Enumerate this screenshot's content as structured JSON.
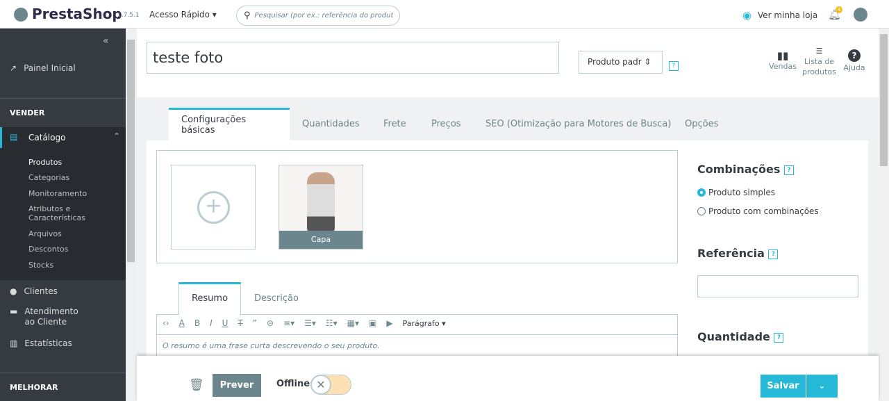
{
  "header": {
    "brand": "PrestaShop",
    "version": "1.7.5.1",
    "quick_access": "Acesso Rápido",
    "search_placeholder": "Pesquisar (por ex.: referência do produt",
    "view_store": "Ver minha loja",
    "notif_count": "4"
  },
  "sidebar": {
    "collapse": "«",
    "dashboard": "Painel Inicial",
    "sell_header": "VENDER",
    "catalog": "Catálogo",
    "catalog_items": [
      "Produtos",
      "Categorias",
      "Monitoramento",
      "Atributos e Características",
      "Arquivos",
      "Descontos",
      "Stocks"
    ],
    "customers": "Clientes",
    "service": "Atendimento ao Cliente",
    "stats": "Estatísticas",
    "improve_header": "MELHORAR"
  },
  "product": {
    "name": "teste foto",
    "type": "Produto padr",
    "help": "?"
  },
  "toolbar": {
    "sales": "Vendas",
    "list": "Lista de produtos",
    "help": "Ajuda"
  },
  "tabs": [
    "Configurações básicas",
    "Quantidades",
    "Frete",
    "Preços",
    "SEO (Otimização para Motores de Busca)",
    "Opções"
  ],
  "images": {
    "cover_label": "Capa"
  },
  "desc_tabs": [
    "Resumo",
    "Descrição"
  ],
  "editor": {
    "paragraph": "Parágrafo",
    "placeholder": "O resumo é uma frase curta descrevendo o seu produto."
  },
  "right": {
    "combinations": "Combinações",
    "simple": "Produto simples",
    "with_comb": "Produto com combinações",
    "reference": "Referência",
    "reference_value": "",
    "quantity": "Quantidade"
  },
  "footer": {
    "preview": "Prever",
    "status": "Offline",
    "save": "Salvar"
  },
  "colors": {
    "accent": "#25b9d7",
    "dark": "#363a41",
    "preview": "#6c868e"
  }
}
